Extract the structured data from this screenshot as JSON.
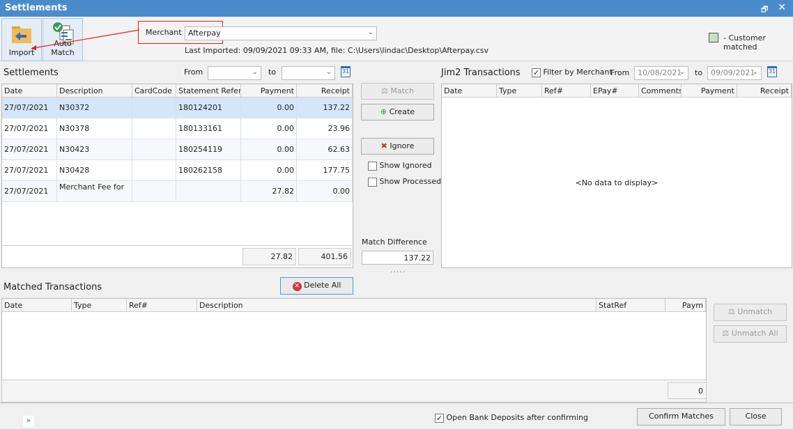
{
  "window": {
    "title": "Settlements",
    "restore_icon": "restore-icon",
    "close_icon": "close-icon",
    "title_color": "#4a8ccb"
  },
  "toolbar": {
    "import_label": "Import",
    "auto_match_label": "Auto Match",
    "merchant_label": "Merchant",
    "merchant_value": "Afterpay",
    "last_imported": "Last Imported: 09/09/2021 09:33 AM, file: C:\\Users\\lindac\\Desktop\\Afterpay.csv",
    "legend_label": "- Customer matched",
    "legend_color": "#c6e0c6"
  },
  "settlements": {
    "title": "Settlements",
    "from_label": "From",
    "to_label": "to",
    "from_value": "",
    "to_value": "",
    "columns": [
      "Date",
      "Description",
      "CardCode",
      "Statement Referer",
      "Payment",
      "Receipt"
    ],
    "rows": [
      [
        "27/07/2021",
        "N30372",
        "",
        "180124201",
        "0.00",
        "137.22"
      ],
      [
        "27/07/2021",
        "N30378",
        "",
        "180133161",
        "0.00",
        "23.96"
      ],
      [
        "27/07/2021",
        "N30423",
        "",
        "180254119",
        "0.00",
        "62.63"
      ],
      [
        "27/07/2021",
        "N30428",
        "",
        "180262158",
        "0.00",
        "177.75"
      ],
      [
        "27/07/2021",
        "Merchant Fee for",
        "",
        "",
        "27.82",
        "0.00"
      ]
    ],
    "total_payment": "27.82",
    "total_receipt": "401.56"
  },
  "actions": {
    "match": "Match",
    "create": "Create",
    "ignore": "Ignore",
    "show_ignored": "Show Ignored",
    "show_processed": "Show Processed",
    "match_difference_label": "Match Difference",
    "match_difference": "137.22"
  },
  "jim2": {
    "title": "Jim2 Transactions",
    "filter_label": "Filter by Merchant",
    "filter_checked": true,
    "from_label": "From",
    "from_value": "10/08/2021",
    "to_label": "to",
    "to_value": "09/09/2021",
    "columns": [
      "Date",
      "Type",
      "Ref#",
      "EPay#",
      "Comments",
      "Payment",
      "Receipt"
    ],
    "empty": "<No data to display>"
  },
  "matched": {
    "title": "Matched Transactions",
    "delete_all": "Delete All",
    "columns": [
      "Date",
      "Type",
      "Ref#",
      "Description",
      "StatRef",
      "Paym"
    ],
    "unmatch": "Unmatch",
    "unmatch_all": "Unmatch All",
    "total": "0"
  },
  "footer": {
    "open_bank_deposits": "Open Bank Deposits after confirming",
    "open_checked": true,
    "confirm": "Confirm Matches",
    "close": "Close",
    "expand": "»"
  }
}
